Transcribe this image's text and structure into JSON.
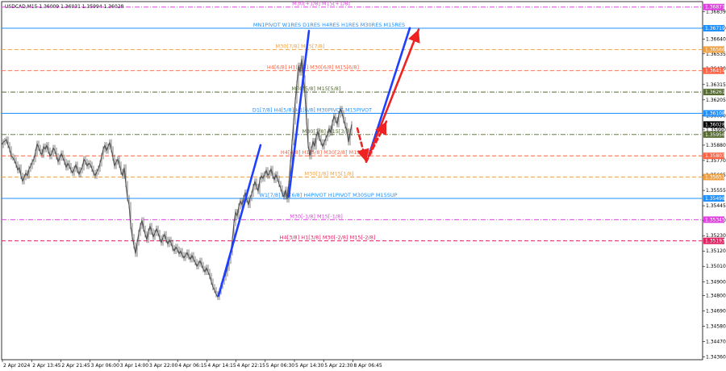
{
  "header": {
    "text": "USDCAD,M15  1.36009 1.36031 1.35994 1.36028"
  },
  "chart_data": {
    "type": "line",
    "title": "USDCAD,M15",
    "ohlc": {
      "open": 1.36009,
      "high": 1.36031,
      "low": 1.35994,
      "close": 1.36028
    },
    "ylim": [
      1.3434,
      1.3691
    ],
    "y_ticks": [
      "1.36839",
      "1.36720",
      "1.36640",
      "1.36535",
      "1.36430",
      "1.36315",
      "1.36205",
      "1.36090",
      "1.35990",
      "1.35880",
      "1.35770",
      "1.35665",
      "1.35555",
      "1.35445",
      "1.35340",
      "1.35230",
      "1.35120",
      "1.35010",
      "1.34900",
      "1.34800",
      "1.34690",
      "1.34580",
      "1.34470",
      "1.34360"
    ],
    "x_ticks": [
      "2 Apr 2024",
      "2 Apr 13:45",
      "2 Apr 21:45",
      "3 Apr 06:00",
      "3 Apr 14:00",
      "3 Apr 22:00",
      "4 Apr 06:15",
      "4 Apr 14:15",
      "4 Apr 22:15",
      "5 Apr 06:30",
      "5 Apr 14:30",
      "5 Apr 22:30",
      "8 Apr 06:45"
    ],
    "levels": [
      {
        "name": "M30[+1/8] M15[+1/8]",
        "price": 1.36871,
        "badge": "1.36871",
        "color": "#e040e0",
        "style": "dashdot"
      },
      {
        "name": "MN1PIVOT W1RES D1RES H4RES H1RES M30RES M15RES",
        "price": 1.36719,
        "badge": "1.36719",
        "color": "#1e90ff",
        "style": "solid"
      },
      {
        "name": "M30[7/8] M15[7/8]",
        "price": 1.36566,
        "badge": "1.36566",
        "color": "#f0a040",
        "style": "dash"
      },
      {
        "name": "H4[6/8] H1[7/8] M30[6/8] M15[6/8]",
        "price": 1.36414,
        "badge": "1.36414",
        "color": "#ff6040",
        "style": "dash"
      },
      {
        "name": "M30[5/8] M15[5/8]",
        "price": 1.36261,
        "badge": "1.36261",
        "color": "#556b2f",
        "style": "dashdot"
      },
      {
        "name": "D1[7/8] H4[5/8] H1[6/8] M30PIVOT M15PIVOT",
        "price": 1.36108,
        "badge": "1.36108",
        "color": "#1e90ff",
        "style": "solid"
      },
      {
        "name": "M30[3/8] M15[3/8]",
        "price": 1.35956,
        "badge": "1.35956",
        "color": "#556b2f",
        "style": "dashdot"
      },
      {
        "name": "H4[4/8] H1[5/8] M30[2/8] M15[2/8]",
        "price": 1.35803,
        "badge": "1.35803",
        "color": "#ff6040",
        "style": "dash"
      },
      {
        "name": "M30[1/8] M15[1/8]",
        "price": 1.35651,
        "badge": "1.35651",
        "color": "#f0a040",
        "style": "dash"
      },
      {
        "name": "W1[7/8] D1[6/8] H4PIVOT H1PIVOT M30SUP M15SUP",
        "price": 1.35498,
        "badge": "1.35498",
        "color": "#1e90ff",
        "style": "solid"
      },
      {
        "name": "M30[-1/8] M15[-1/8]",
        "price": 1.35345,
        "badge": "1.35345",
        "color": "#e040e0",
        "style": "dashdot"
      },
      {
        "name": "H4[3/8] H1[3/8] M30[-2/8] M15[-2/8]",
        "price": 1.35193,
        "badge": "1.35193",
        "color": "#e02060",
        "style": "dash"
      }
    ],
    "current_price": {
      "price": 1.36028,
      "badge": "1.36028"
    },
    "series": [
      {
        "values": [
          [
            0,
            1.3588
          ],
          [
            2,
            1.359
          ],
          [
            4,
            1.3591
          ],
          [
            6,
            1.3592
          ],
          [
            8,
            1.3588
          ],
          [
            10,
            1.3585
          ],
          [
            12,
            1.358
          ],
          [
            14,
            1.3579
          ],
          [
            16,
            1.3577
          ],
          [
            18,
            1.3574
          ],
          [
            20,
            1.357
          ],
          [
            22,
            1.3572
          ],
          [
            24,
            1.3566
          ],
          [
            26,
            1.3562
          ],
          [
            28,
            1.3565
          ],
          [
            30,
            1.3568
          ],
          [
            32,
            1.3566
          ],
          [
            34,
            1.3571
          ],
          [
            36,
            1.3573
          ],
          [
            38,
            1.3576
          ],
          [
            40,
            1.3578
          ],
          [
            42,
            1.3583
          ],
          [
            44,
            1.3589
          ],
          [
            46,
            1.3586
          ],
          [
            48,
            1.3583
          ],
          [
            50,
            1.3581
          ],
          [
            52,
            1.3587
          ],
          [
            54,
            1.3585
          ],
          [
            56,
            1.3588
          ],
          [
            58,
            1.3584
          ],
          [
            60,
            1.358
          ],
          [
            62,
            1.3582
          ],
          [
            64,
            1.3586
          ],
          [
            66,
            1.3584
          ],
          [
            68,
            1.358
          ],
          [
            70,
            1.3576
          ],
          [
            72,
            1.3579
          ],
          [
            74,
            1.3582
          ],
          [
            76,
            1.3579
          ],
          [
            78,
            1.3576
          ],
          [
            80,
            1.3572
          ],
          [
            82,
            1.3575
          ],
          [
            84,
            1.3573
          ],
          [
            86,
            1.357
          ],
          [
            88,
            1.3568
          ],
          [
            90,
            1.3571
          ],
          [
            92,
            1.3574
          ],
          [
            94,
            1.357
          ],
          [
            96,
            1.3567
          ],
          [
            98,
            1.357
          ],
          [
            100,
            1.3572
          ],
          [
            102,
            1.3578
          ],
          [
            104,
            1.3576
          ],
          [
            106,
            1.3573
          ],
          [
            108,
            1.3575
          ],
          [
            110,
            1.3574
          ],
          [
            112,
            1.3571
          ],
          [
            114,
            1.3568
          ],
          [
            116,
            1.3566
          ],
          [
            118,
            1.3569
          ],
          [
            120,
            1.3571
          ],
          [
            122,
            1.3575
          ],
          [
            124,
            1.358
          ],
          [
            126,
            1.3585
          ],
          [
            128,
            1.3588
          ],
          [
            130,
            1.3584
          ],
          [
            132,
            1.3587
          ],
          [
            134,
            1.359
          ],
          [
            136,
            1.3585
          ],
          [
            138,
            1.3579
          ],
          [
            140,
            1.3573
          ],
          [
            142,
            1.3576
          ],
          [
            144,
            1.3578
          ],
          [
            146,
            1.3574
          ],
          [
            148,
            1.3569
          ],
          [
            150,
            1.3566
          ],
          [
            152,
            1.3572
          ],
          [
            154,
            1.356
          ],
          [
            156,
            1.355
          ],
          [
            158,
            1.3545
          ],
          [
            160,
            1.353
          ],
          [
            162,
            1.3522
          ],
          [
            164,
            1.3516
          ],
          [
            166,
            1.351
          ],
          [
            168,
            1.3518
          ],
          [
            170,
            1.3525
          ],
          [
            172,
            1.353
          ],
          [
            174,
            1.3534
          ],
          [
            176,
            1.3528
          ],
          [
            178,
            1.3524
          ],
          [
            180,
            1.352
          ],
          [
            182,
            1.3526
          ],
          [
            184,
            1.353
          ],
          [
            186,
            1.3526
          ],
          [
            188,
            1.3522
          ],
          [
            190,
            1.3525
          ],
          [
            192,
            1.3528
          ],
          [
            194,
            1.3525
          ],
          [
            196,
            1.3521
          ],
          [
            198,
            1.3518
          ],
          [
            200,
            1.3522
          ],
          [
            202,
            1.3524
          ],
          [
            204,
            1.352
          ],
          [
            206,
            1.3517
          ],
          [
            208,
            1.352
          ],
          [
            210,
            1.3518
          ],
          [
            212,
            1.3514
          ],
          [
            214,
            1.3512
          ],
          [
            216,
            1.3515
          ],
          [
            218,
            1.3513
          ],
          [
            220,
            1.351
          ],
          [
            222,
            1.3512
          ],
          [
            224,
            1.3509
          ],
          [
            226,
            1.3507
          ],
          [
            228,
            1.3509
          ],
          [
            230,
            1.3511
          ],
          [
            232,
            1.3508
          ],
          [
            234,
            1.3506
          ],
          [
            236,
            1.3509
          ],
          [
            238,
            1.3506
          ],
          [
            240,
            1.3504
          ],
          [
            242,
            1.3501
          ],
          [
            244,
            1.3503
          ],
          [
            246,
            1.3505
          ],
          [
            248,
            1.3502
          ],
          [
            250,
            1.3499
          ],
          [
            252,
            1.3497
          ],
          [
            254,
            1.35
          ],
          [
            256,
            1.3497
          ],
          [
            258,
            1.3494
          ],
          [
            260,
            1.349
          ],
          [
            262,
            1.3486
          ],
          [
            264,
            1.3484
          ],
          [
            266,
            1.3481
          ],
          [
            268,
            1.3479
          ],
          [
            270,
            1.3483
          ],
          [
            272,
            1.3487
          ],
          [
            274,
            1.349
          ],
          [
            276,
            1.3493
          ],
          [
            278,
            1.3496
          ],
          [
            280,
            1.35
          ],
          [
            282,
            1.3505
          ],
          [
            284,
            1.3511
          ],
          [
            286,
            1.352
          ],
          [
            288,
            1.3532
          ],
          [
            290,
            1.354
          ],
          [
            292,
            1.3537
          ],
          [
            294,
            1.3544
          ],
          [
            296,
            1.3548
          ],
          [
            298,
            1.3545
          ],
          [
            300,
            1.355
          ],
          [
            302,
            1.3554
          ],
          [
            304,
            1.3549
          ],
          [
            306,
            1.3545
          ],
          [
            308,
            1.355
          ],
          [
            310,
            1.3553
          ],
          [
            312,
            1.3558
          ],
          [
            314,
            1.3562
          ],
          [
            316,
            1.3558
          ],
          [
            318,
            1.3555
          ],
          [
            320,
            1.3563
          ],
          [
            322,
            1.3566
          ],
          [
            324,
            1.3564
          ],
          [
            326,
            1.3567
          ],
          [
            328,
            1.357
          ],
          [
            330,
            1.3566
          ],
          [
            332,
            1.3568
          ],
          [
            334,
            1.3571
          ],
          [
            336,
            1.3566
          ],
          [
            338,
            1.3563
          ],
          [
            340,
            1.3567
          ],
          [
            342,
            1.3564
          ],
          [
            344,
            1.356
          ],
          [
            346,
            1.3557
          ],
          [
            348,
            1.3553
          ],
          [
            350,
            1.3551
          ],
          [
            352,
            1.3556
          ],
          [
            354,
            1.3549
          ],
          [
            356,
            1.356
          ],
          [
            358,
            1.3575
          ],
          [
            360,
            1.359
          ],
          [
            362,
            1.3605
          ],
          [
            364,
            1.362
          ],
          [
            366,
            1.3632
          ],
          [
            368,
            1.3645
          ],
          [
            370,
            1.364
          ],
          [
            372,
            1.365
          ],
          [
            374,
            1.3636
          ],
          [
            376,
            1.3625
          ],
          [
            378,
            1.3605
          ],
          [
            380,
            1.3588
          ],
          [
            382,
            1.358
          ],
          [
            384,
            1.3585
          ],
          [
            386,
            1.3591
          ],
          [
            388,
            1.3587
          ],
          [
            390,
            1.3594
          ],
          [
            392,
            1.3598
          ],
          [
            394,
            1.3593
          ],
          [
            396,
            1.359
          ],
          [
            398,
            1.3587
          ],
          [
            400,
            1.359
          ],
          [
            402,
            1.3593
          ],
          [
            404,
            1.3596
          ],
          [
            406,
            1.36
          ],
          [
            408,
            1.3597
          ],
          [
            410,
            1.3604
          ],
          [
            412,
            1.3609
          ],
          [
            414,
            1.3606
          ],
          [
            416,
            1.3603
          ],
          [
            418,
            1.361
          ],
          [
            420,
            1.3614
          ],
          [
            422,
            1.3611
          ],
          [
            424,
            1.3606
          ],
          [
            426,
            1.3602
          ],
          [
            428,
            1.3598
          ],
          [
            430,
            1.359
          ],
          [
            432,
            1.3597
          ],
          [
            434,
            1.3603
          ]
        ]
      }
    ],
    "annotations": [
      {
        "type": "arrow",
        "color": "#1f3fff",
        "from": [
          269,
          1.348
        ],
        "to": [
          321,
          1.3588
        ]
      },
      {
        "type": "arrow",
        "color": "#1f3fff",
        "from": [
          356,
          1.3551
        ],
        "to": [
          381,
          1.367
        ]
      },
      {
        "type": "arrow",
        "color": "#1f3fff",
        "from": [
          455,
          1.358
        ],
        "to": [
          506,
          1.3672
        ]
      },
      {
        "type": "arrow",
        "color": "#ee2222",
        "from": [
          455,
          1.358
        ],
        "to": [
          517,
          1.3671
        ]
      },
      {
        "type": "dashed-arrow",
        "color": "#ee2222",
        "from": [
          441,
          1.36
        ],
        "to": [
          452,
          1.3576
        ]
      },
      {
        "type": "dashed-arrow",
        "color": "#ee2222",
        "from": [
          452,
          1.3576
        ],
        "to": [
          477,
          1.3605
        ]
      }
    ]
  }
}
